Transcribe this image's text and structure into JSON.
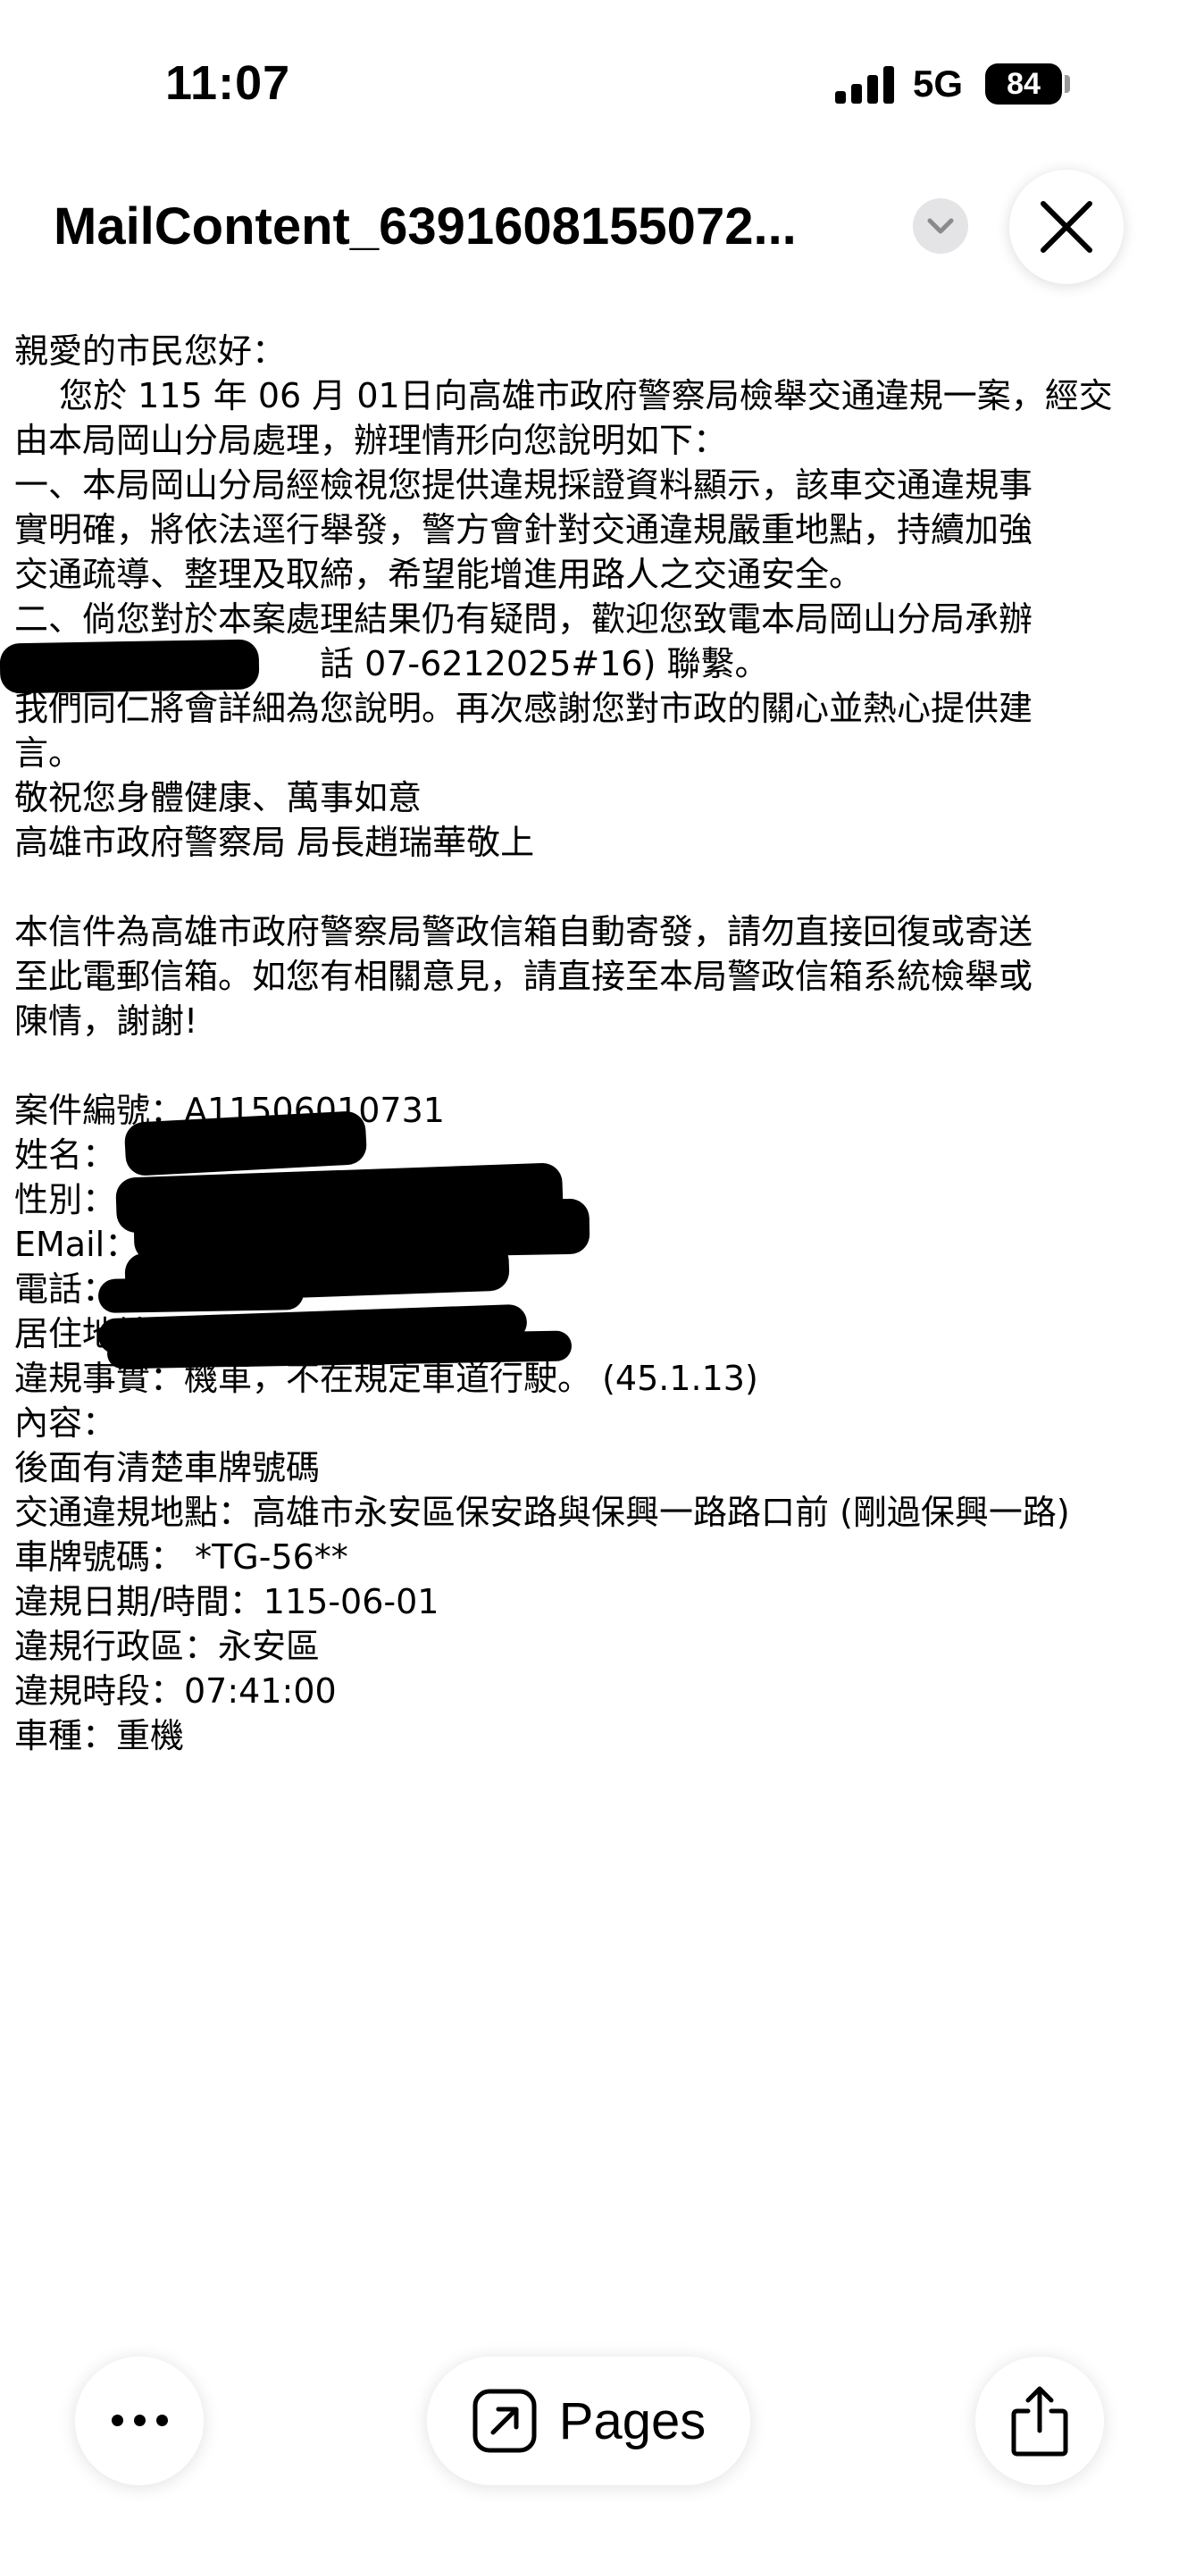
{
  "status_bar": {
    "time": "11:07",
    "network": "5G",
    "battery": "84"
  },
  "header": {
    "title": "MailContent_6391608155072...",
    "chevron_icon": "chevron-down-icon",
    "close_icon": "close-icon"
  },
  "email": {
    "lines": [
      "親愛的市民您好：",
      "　 您於 115 年 06 月 01日向高雄市政府警察局檢舉交通違規一案，經交",
      "由本局岡山分局處理，辦理情形向您說明如下：",
      "一、本局岡山分局經檢視您提供違規採證資料顯示，該車交通違規事",
      "實明確，將依法逕行舉發，警方會針對交通違規嚴重地點，持續加強",
      "交通疏導、整理及取締，希望能增進用路人之交通安全。",
      "二、倘您對於本案處理結果仍有疑問，歡迎您致電本局岡山分局承辦",
      "　　　　　　　　　話 07-6212025#16) 聯繫。",
      "我們同仁將會詳細為您說明。再次感謝您對市政的關心並熱心提供建",
      "言。",
      "敬祝您身體健康、萬事如意",
      "高雄市政府警察局 局長趙瑞華敬上",
      "",
      "本信件為高雄市政府警察局警政信箱自動寄發，請勿直接回復或寄送",
      "至此電郵信箱。如您有相關意見，請直接至本局警政信箱系統檢舉或",
      "陳情，謝謝!",
      "",
      "案件編號：A11506010731",
      "姓名：",
      "性別：",
      "EMail：",
      "電話：",
      "居住地址：",
      "違規事實：機車，不在規定車道行駛。 (45.1.13)",
      "內容：",
      "後面有清楚車牌號碼",
      "交通違規地點：高雄市永安區保安路與保興一路路口前 (剛過保興一路)",
      "車牌號碼： *TG-56**",
      "違規日期/時間：115-06-01",
      "違規行政區：永安區",
      "違規時段：07:41:00",
      "車種：重機"
    ]
  },
  "toolbar": {
    "more_icon": "more-icon",
    "pages_label": "Pages",
    "pages_icon": "open-external-icon",
    "share_icon": "share-icon"
  }
}
